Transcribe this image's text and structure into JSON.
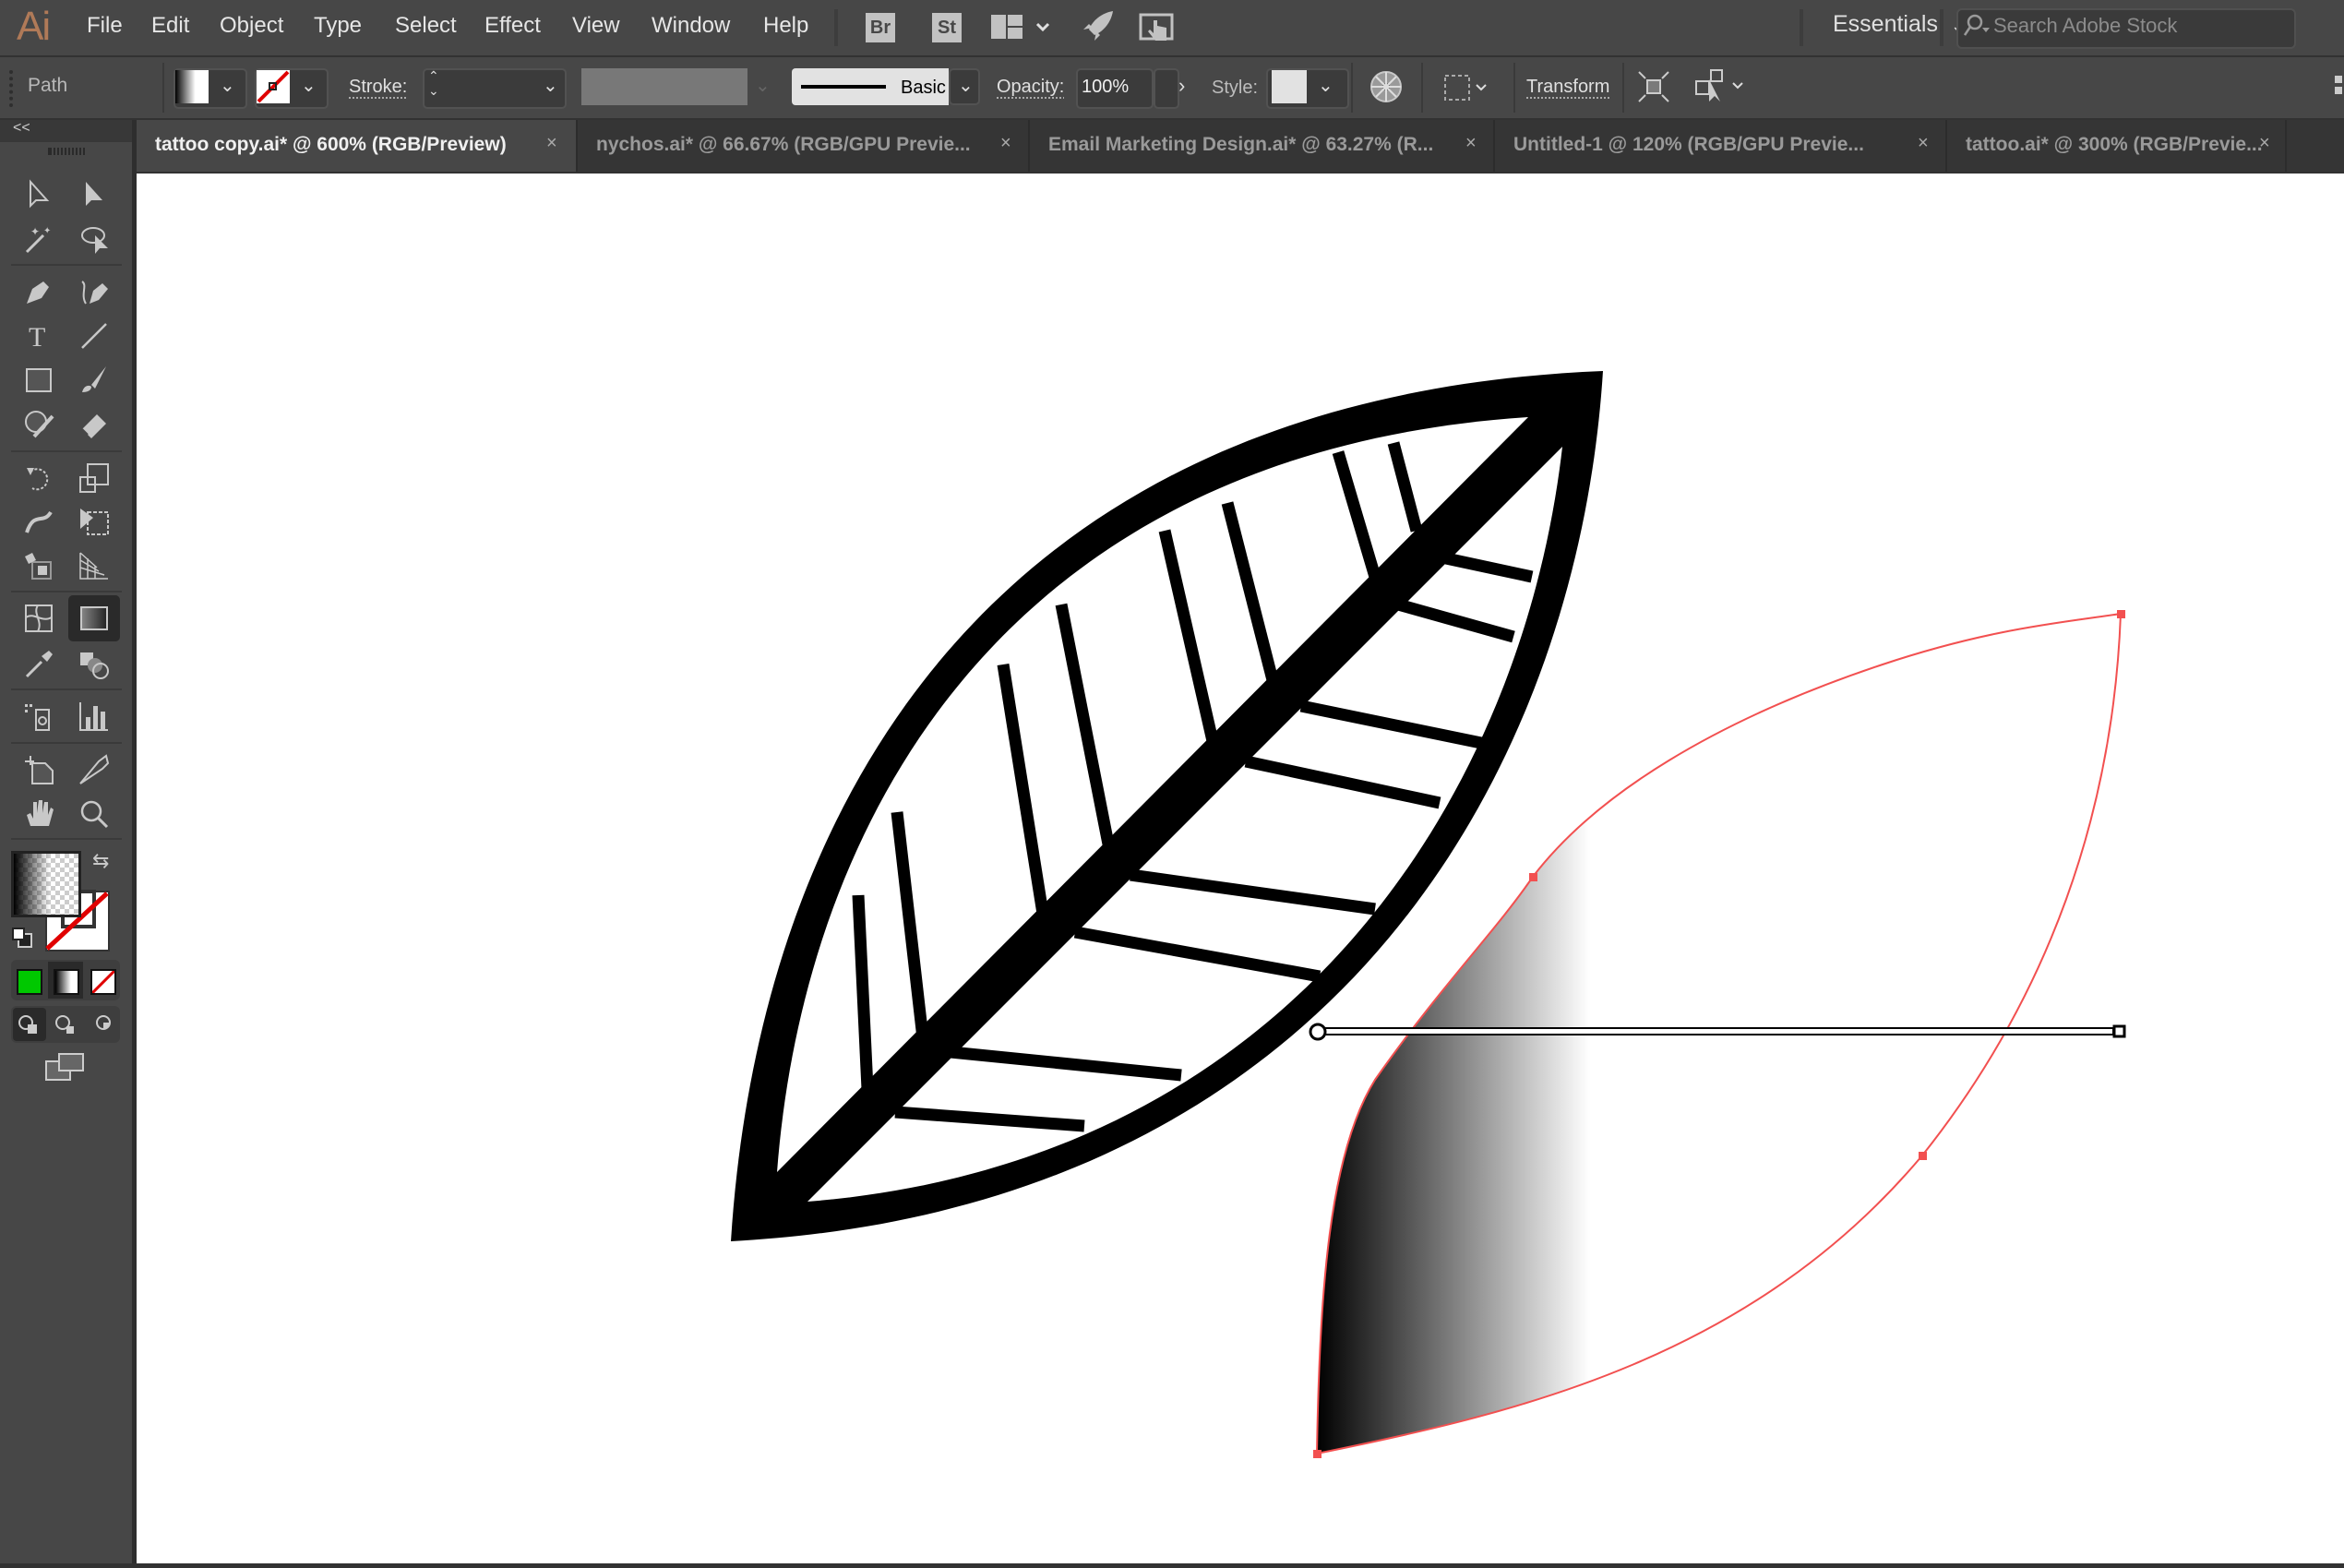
{
  "app": {
    "logo": "Ai"
  },
  "menubar": {
    "items": [
      "File",
      "Edit",
      "Object",
      "Type",
      "Select",
      "Effect",
      "View",
      "Window",
      "Help"
    ],
    "bridge_label": "Br",
    "stock_label": "St",
    "workspace": "Essentials",
    "search_placeholder": "Search Adobe Stock"
  },
  "controlbar": {
    "selection_type": "Path",
    "stroke_label": "Stroke:",
    "stroke_value": "",
    "brush_label": "Basic",
    "opacity_label": "Opacity:",
    "opacity_value": "100%",
    "style_label": "Style:",
    "transform_label": "Transform"
  },
  "tabs": [
    {
      "label": "tattoo copy.ai* @ 600% (RGB/Preview)",
      "active": true
    },
    {
      "label": "nychos.ai* @ 66.67% (RGB/GPU Previe...",
      "active": false
    },
    {
      "label": "Email Marketing Design.ai* @ 63.27% (R...",
      "active": false
    },
    {
      "label": "Untitled-1 @ 120% (RGB/GPU Previe...",
      "active": false
    },
    {
      "label": "tattoo.ai* @ 300% (RGB/Previe...",
      "active": false
    }
  ],
  "tab_close_glyph": "×",
  "toolbar": {
    "collapse_glyph": "<<",
    "tools": [
      [
        "selection-tool",
        "direct-selection-tool"
      ],
      [
        "magic-wand-tool",
        "lasso-tool"
      ],
      [
        "pen-tool",
        "curvature-tool"
      ],
      [
        "type-tool",
        "line-segment-tool"
      ],
      [
        "rectangle-tool",
        "paintbrush-tool"
      ],
      [
        "shaper-tool",
        "eraser-tool"
      ],
      [
        "rotate-tool",
        "scale-tool"
      ],
      [
        "warp-tool",
        "free-transform-tool"
      ],
      [
        "shape-builder-tool",
        "perspective-grid-tool"
      ],
      [
        "mesh-tool",
        "gradient-tool"
      ],
      [
        "eyedropper-tool",
        "blend-tool"
      ],
      [
        "symbol-sprayer-tool",
        "column-graph-tool"
      ],
      [
        "artboard-tool",
        "slice-tool"
      ],
      [
        "hand-tool",
        "zoom-tool"
      ]
    ],
    "active_tool": "gradient-tool"
  },
  "colors": {
    "accent_logo": "#b07a58",
    "path_highlight": "#f25050",
    "fill_color_green": "#00c800",
    "none_red": "#e00000"
  },
  "artwork": {
    "gradient": {
      "type": "linear",
      "stops": [
        {
          "color": "#000000",
          "offset": 0
        },
        {
          "color": "#ffffff",
          "offset": 0.34
        }
      ]
    }
  }
}
